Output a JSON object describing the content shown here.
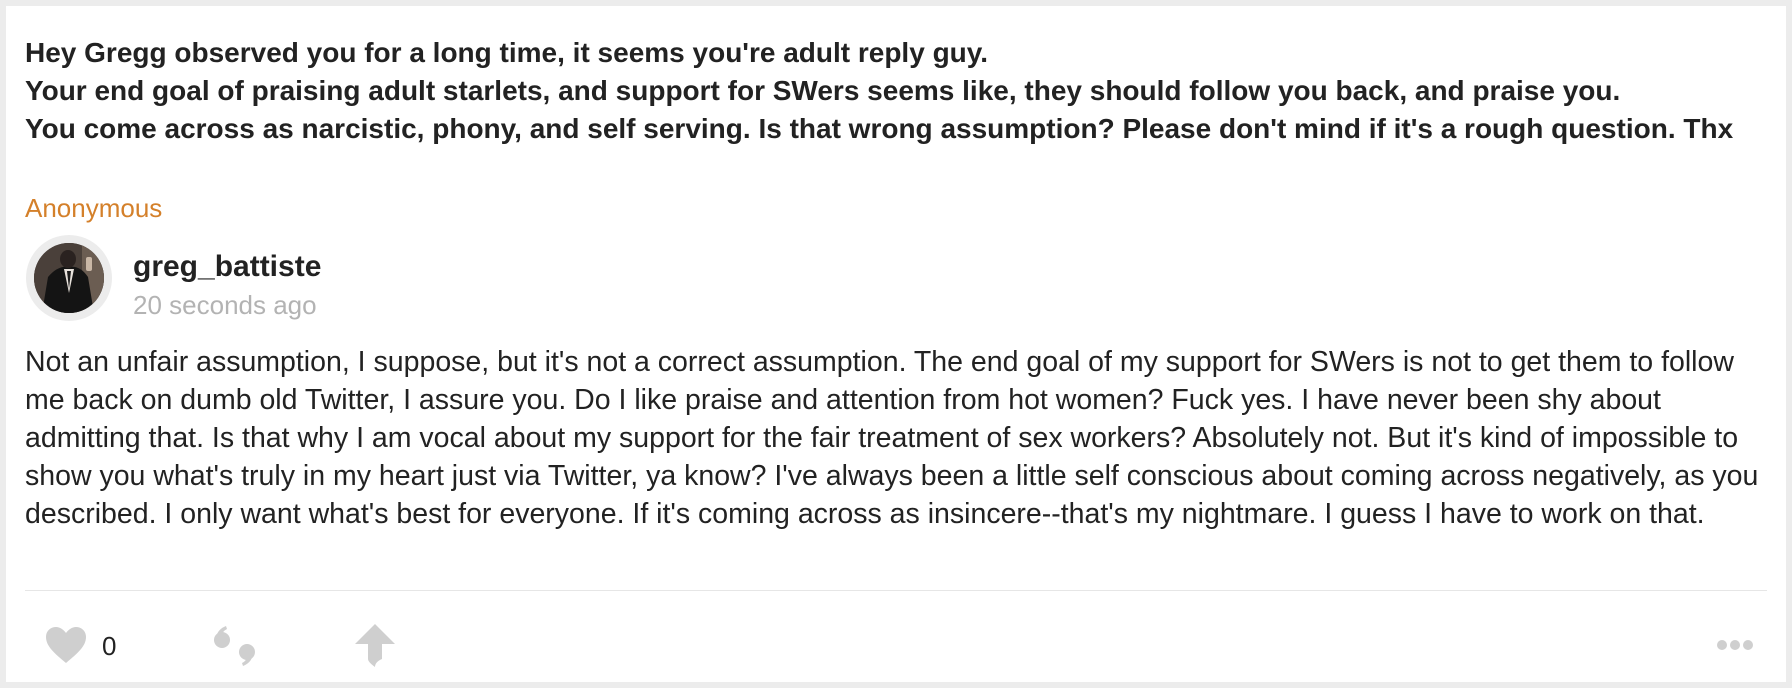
{
  "question": {
    "lines": [
      "Hey Gregg observed you for a long time, it seems you're adult reply guy.",
      "Your end goal of praising adult starlets, and support for SWers seems like, they should follow you back, and praise you.",
      "You come across as narcistic, phony,  and self serving. Is that wrong assumption? Please don't mind if it's a rough question. Thx"
    ]
  },
  "asker": "Anonymous",
  "answerer": {
    "username": "greg_battiste",
    "timestamp": "20 seconds ago"
  },
  "answer": "Not an unfair assumption, I suppose, but it's not a correct assumption. The end goal of my support for SWers is not to get them to follow me back on dumb old Twitter, I assure you. Do I like praise and attention from hot women? Fuck yes. I have never been shy about admitting that. Is that why I am vocal about my support for the fair treatment of sex workers? Absolutely not. But it's kind of impossible to show you what's truly in my heart just via Twitter, ya know? I've always been a little self conscious about coming across negatively, as you described. I only want what's best for everyone. If it's coming across as insincere--that's my nightmare. I guess I have to work on that.",
  "actions": {
    "like_count": "0",
    "like_icon": "heart-icon",
    "quote_icon": "quote-icon",
    "share_icon": "share-arrow-icon",
    "more_icon": "more-dots-icon",
    "icon_color": "#cfcfcf"
  },
  "colors": {
    "asker": "#d4802a",
    "muted": "#b3b3b3",
    "text": "#222222"
  }
}
